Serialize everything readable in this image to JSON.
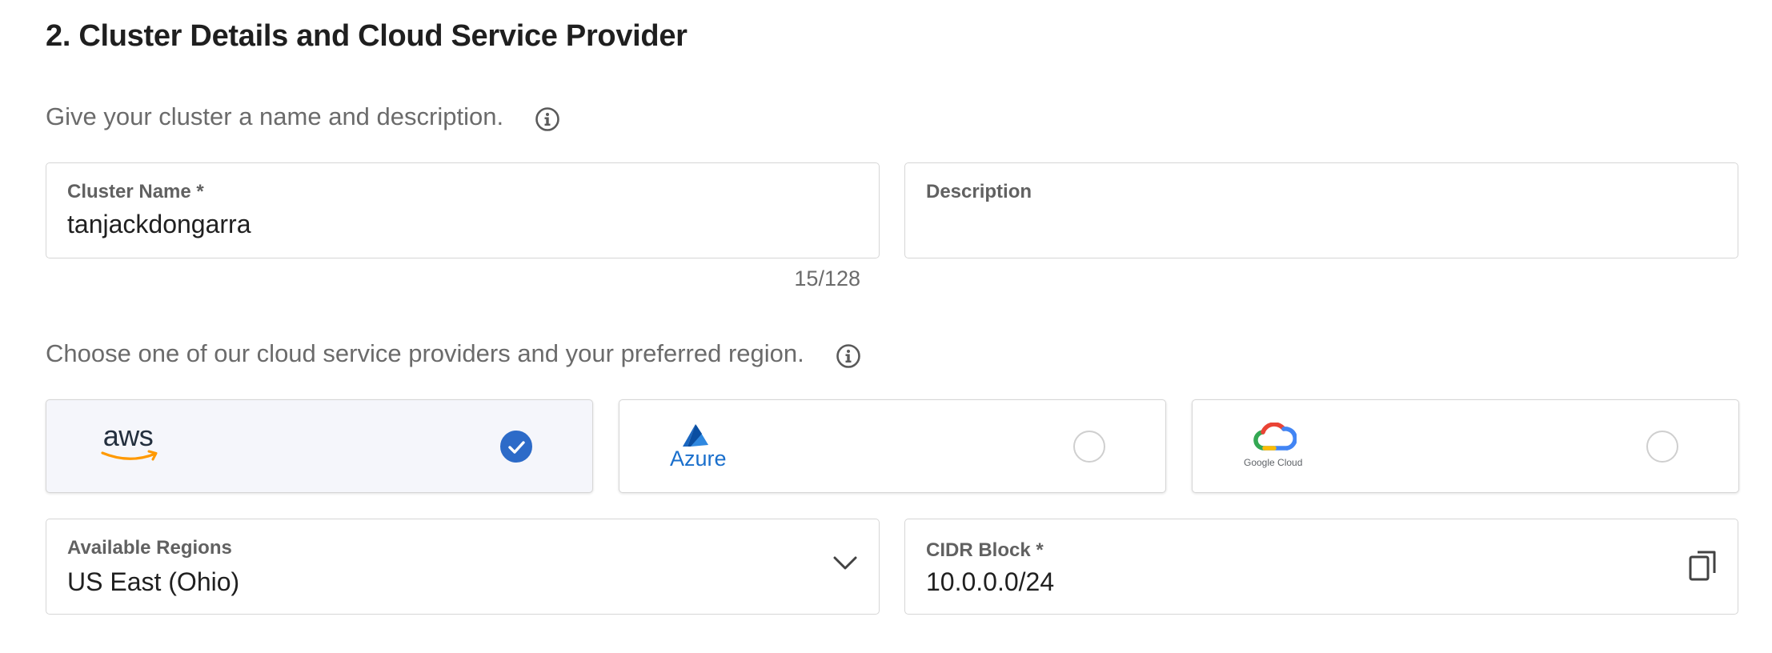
{
  "section": {
    "title": "2. Cluster Details and Cloud Service Provider"
  },
  "name_section": {
    "prompt": "Give your cluster a name and description."
  },
  "cluster_name": {
    "label": "Cluster Name *",
    "value": "tanjackdongarra",
    "counter": "15/128"
  },
  "description": {
    "label": "Description",
    "value": ""
  },
  "provider_section": {
    "prompt": "Choose one of our cloud service providers and your preferred region."
  },
  "providers": [
    {
      "name": "aws",
      "logo_text": "aws",
      "selected": true
    },
    {
      "name": "Azure",
      "logo_text": "Azure",
      "selected": false
    },
    {
      "name": "Google Cloud",
      "logo_text": "Google Cloud",
      "selected": false
    }
  ],
  "regions": {
    "label": "Available Regions",
    "value": "US East (Ohio)"
  },
  "cidr": {
    "label": "CIDR Block *",
    "value": "10.0.0.0/24"
  },
  "colors": {
    "accent": "#2d6bc8",
    "aws_orange": "#ff9900",
    "azure_blue": "#0078d4"
  },
  "icons": {
    "info": "info-icon",
    "check": "check-icon",
    "chevron": "chevron-down-icon",
    "copy": "copy-icon"
  }
}
